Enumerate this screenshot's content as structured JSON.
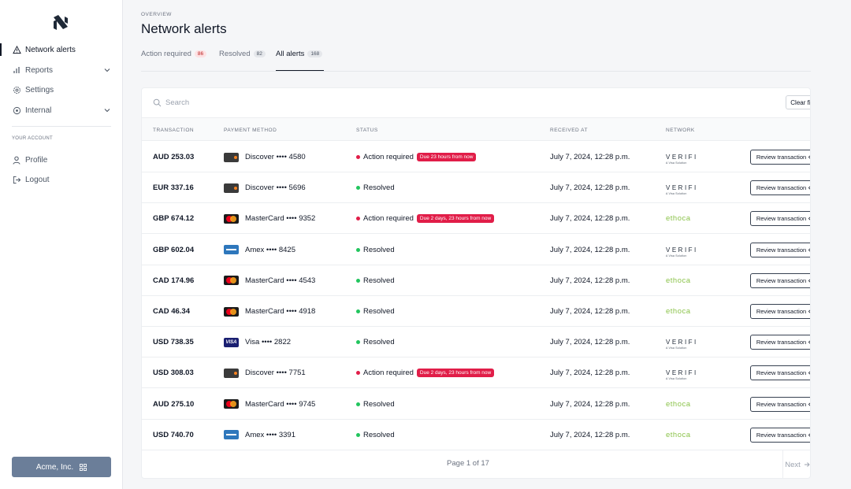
{
  "sidebar": {
    "items": [
      {
        "label": "Network alerts",
        "icon": "warning-icon"
      },
      {
        "label": "Reports",
        "icon": "bar-chart-icon"
      },
      {
        "label": "Settings",
        "icon": "gear-icon"
      },
      {
        "label": "Internal",
        "icon": "target-icon"
      }
    ],
    "account_section": "YOUR ACCOUNT",
    "account_items": [
      {
        "label": "Profile",
        "icon": "user-icon"
      },
      {
        "label": "Logout",
        "icon": "logout-icon"
      }
    ],
    "org_button": "Acme, Inc."
  },
  "header": {
    "overline": "OVERVIEW",
    "title": "Network alerts"
  },
  "tabs": [
    {
      "label": "Action required",
      "count": "86"
    },
    {
      "label": "Resolved",
      "count": "82"
    },
    {
      "label": "All alerts",
      "count": "168"
    }
  ],
  "search": {
    "placeholder": "Search"
  },
  "clear_filters": "Clear filters",
  "columns": [
    "TRANSACTION",
    "PAYMENT METHOD",
    "STATUS",
    "RECEIVED AT",
    "NETWORK"
  ],
  "rows": [
    {
      "amount": "AUD 253.03",
      "method": "Discover •••• 4580",
      "card": "discover",
      "status": "Action required",
      "due": "Due 23 hours from now",
      "received": "July 7, 2024, 12:28 p.m.",
      "network": "verifi"
    },
    {
      "amount": "EUR 337.16",
      "method": "Discover •••• 5696",
      "card": "discover",
      "status": "Resolved",
      "due": "",
      "received": "July 7, 2024, 12:28 p.m.",
      "network": "verifi"
    },
    {
      "amount": "GBP 674.12",
      "method": "MasterCard •••• 9352",
      "card": "mastercard",
      "status": "Action required",
      "due": "Due 2 days, 23 hours from now",
      "received": "July 7, 2024, 12:28 p.m.",
      "network": "ethoca"
    },
    {
      "amount": "GBP 602.04",
      "method": "Amex •••• 8425",
      "card": "amex",
      "status": "Resolved",
      "due": "",
      "received": "July 7, 2024, 12:28 p.m.",
      "network": "verifi"
    },
    {
      "amount": "CAD 174.96",
      "method": "MasterCard •••• 4543",
      "card": "mastercard",
      "status": "Resolved",
      "due": "",
      "received": "July 7, 2024, 12:28 p.m.",
      "network": "ethoca"
    },
    {
      "amount": "CAD 46.34",
      "method": "MasterCard •••• 4918",
      "card": "mastercard",
      "status": "Resolved",
      "due": "",
      "received": "July 7, 2024, 12:28 p.m.",
      "network": "ethoca"
    },
    {
      "amount": "USD 738.35",
      "method": "Visa •••• 2822",
      "card": "visa",
      "status": "Resolved",
      "due": "",
      "received": "July 7, 2024, 12:28 p.m.",
      "network": "verifi"
    },
    {
      "amount": "USD 308.03",
      "method": "Discover •••• 7751",
      "card": "discover",
      "status": "Action required",
      "due": "Due 2 days, 23 hours from now",
      "received": "July 7, 2024, 12:28 p.m.",
      "network": "verifi"
    },
    {
      "amount": "AUD 275.10",
      "method": "MasterCard •••• 9745",
      "card": "mastercard",
      "status": "Resolved",
      "due": "",
      "received": "July 7, 2024, 12:28 p.m.",
      "network": "ethoca"
    },
    {
      "amount": "USD 740.70",
      "method": "Amex •••• 3391",
      "card": "amex",
      "status": "Resolved",
      "due": "",
      "received": "July 7, 2024, 12:28 p.m.",
      "network": "ethoca"
    }
  ],
  "review_label": "Review transaction",
  "network_labels": {
    "verifi": "VERIFI",
    "verifi_sub": "A Visa Solution",
    "ethoca": "ethoca"
  },
  "card_labels": {
    "visa": "VISA"
  },
  "pagination": {
    "info": "Page 1 of 17",
    "next": "Next"
  },
  "colors": {
    "action": "#e11d48",
    "resolved": "#22c55e",
    "ethoca": "#8bc34a",
    "account_button": "#6b7e99"
  }
}
